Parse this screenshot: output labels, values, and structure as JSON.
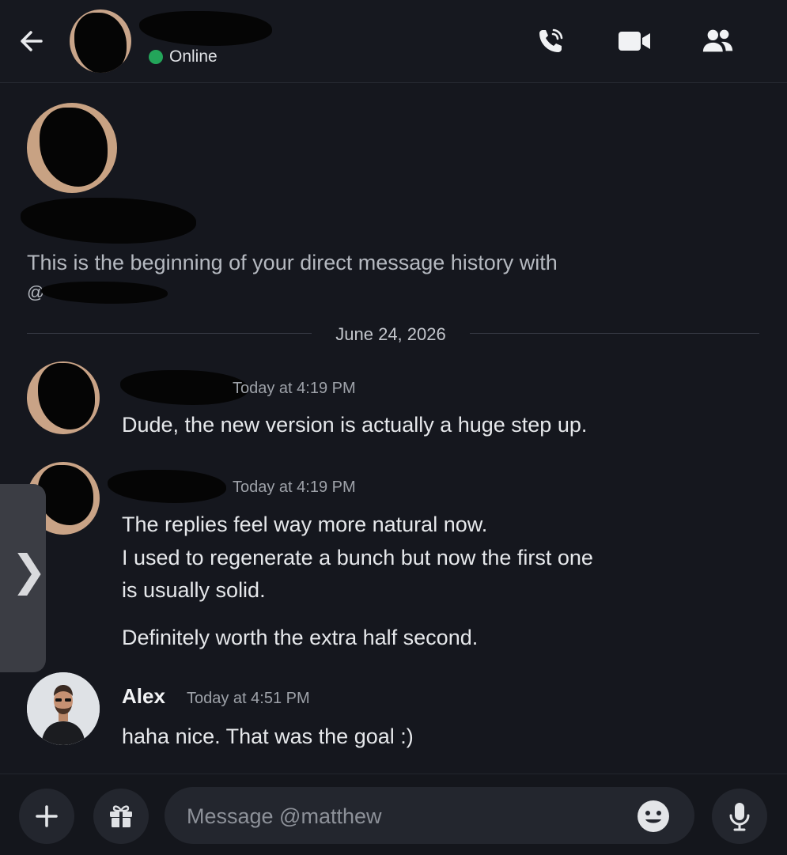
{
  "header": {
    "status": "Online",
    "status_color": "#23a55a",
    "icons": [
      "back-arrow-icon",
      "voice-call-icon",
      "video-camera-icon",
      "members-icon"
    ]
  },
  "intro": {
    "text": "This is the beginning of your direct message history with",
    "handle_prefix": "@"
  },
  "date_divider": "June 24, 2026",
  "messages": [
    {
      "timestamp": "Today at 4:19 PM",
      "lines": [
        "Dude, the new version is actually a huge step up."
      ]
    },
    {
      "timestamp": "Today at 4:19 PM",
      "lines": [
        "The replies feel way more natural now.",
        "I used to regenerate a bunch but now the first one",
        "is usually solid.",
        "Definitely worth the extra half second."
      ]
    },
    {
      "author": "Alex",
      "timestamp": "Today at 4:51 PM",
      "lines": [
        "haha nice. That was the goal :)"
      ]
    }
  ],
  "side_tab": {
    "icon": "chevron-right-icon"
  },
  "composer": {
    "placeholder": "Message @matthew",
    "icons": [
      "plus-icon",
      "gift-icon",
      "emoji-icon",
      "microphone-icon"
    ]
  }
}
